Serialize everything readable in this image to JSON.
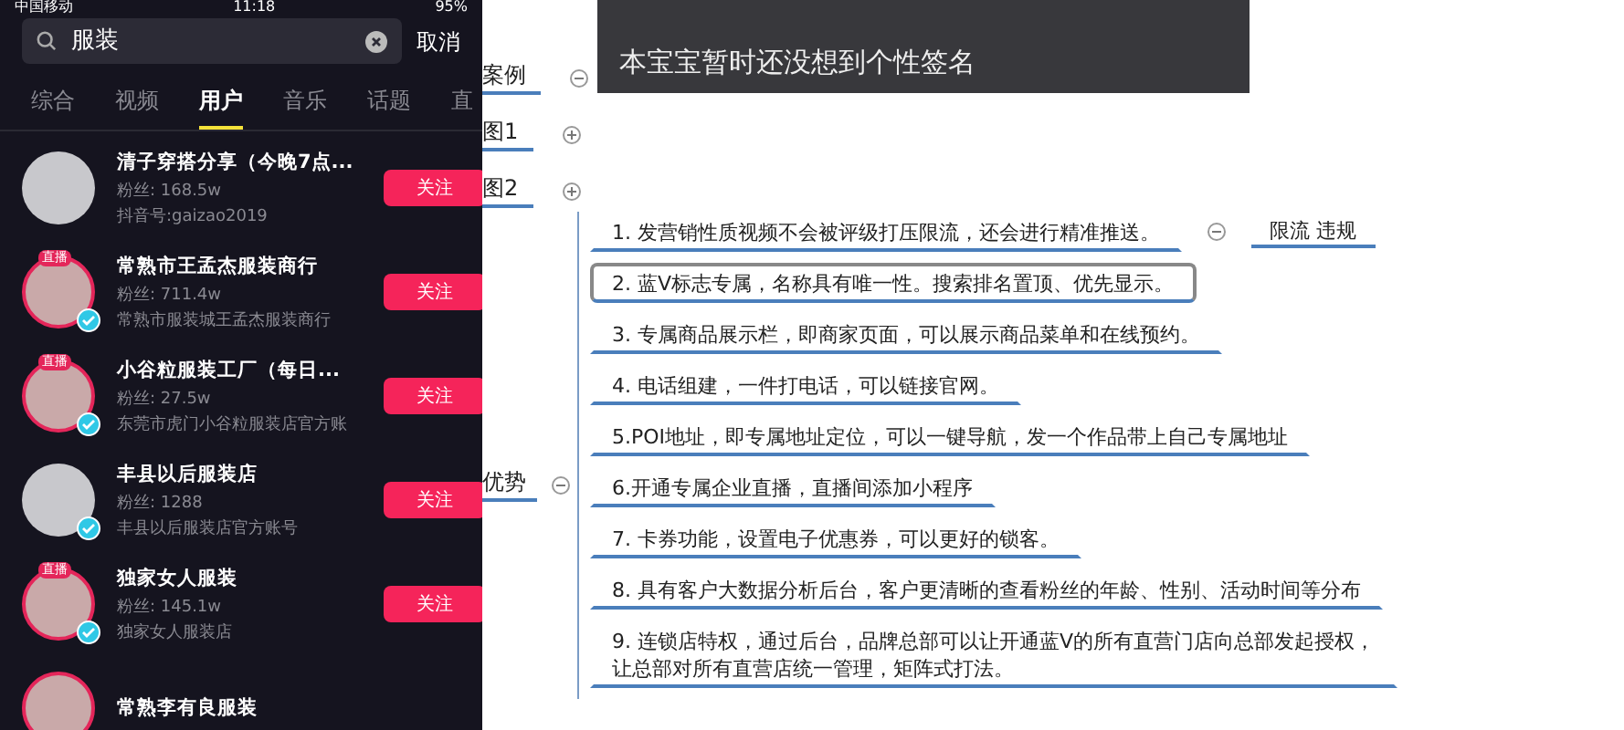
{
  "phone": {
    "status_bar": {
      "carrier": "中国移动",
      "time": "11:18",
      "battery": "95%"
    },
    "search": {
      "value": "服装",
      "cancel": "取消"
    },
    "tabs": [
      {
        "label": "综合",
        "selected": false
      },
      {
        "label": "视频",
        "selected": false
      },
      {
        "label": "用户",
        "selected": true
      },
      {
        "label": "音乐",
        "selected": false
      },
      {
        "label": "话题",
        "selected": false
      },
      {
        "label": "直",
        "selected": false
      }
    ],
    "users": [
      {
        "name": "清子穿搭分享（今晚7点...",
        "fans": "粉丝: 168.5w",
        "sub": "抖音号:gaizao2019",
        "live": false,
        "verified": false,
        "button": "关注"
      },
      {
        "name": "常熟市王孟杰服装商行",
        "fans": "粉丝: 711.4w",
        "sub": "常熟市服装城王孟杰服装商行",
        "live": true,
        "live_badge": "直播",
        "verified": true,
        "button": "关注"
      },
      {
        "name": "小谷粒服装工厂（每日...",
        "fans": "粉丝: 27.5w",
        "sub": "东莞市虎门小谷粒服装店官方账",
        "live": true,
        "live_badge": "直播",
        "verified": true,
        "button": "关注"
      },
      {
        "name": "丰县以后服装店",
        "fans": "粉丝: 1288",
        "sub": "丰县以后服装店官方账号",
        "live": false,
        "verified": true,
        "button": "关注"
      },
      {
        "name": "独家女人服装",
        "fans": "粉丝: 145.1w",
        "sub": "独家女人服装店",
        "live": true,
        "live_badge": "直播",
        "verified": true,
        "button": "关注"
      },
      {
        "name": "常熟李有良服装",
        "live": true,
        "verified": false
      }
    ]
  },
  "mindmap": {
    "popup": {
      "text": "本宝宝暂时还没想到个性签名"
    },
    "side_nodes": [
      {
        "label": "案例",
        "expanded": true
      },
      {
        "label": "图1",
        "expanded": false
      },
      {
        "label": "图2",
        "expanded": false
      }
    ],
    "branch": {
      "label": "优势",
      "expanded": true,
      "children": [
        {
          "text": "1. 发营销性质视频不会被评级打压限流，还会进行精准推送。",
          "selected": false,
          "expanded": true,
          "children": [
            {
              "text": "限流 违规"
            }
          ]
        },
        {
          "text": "2. 蓝V标志专属，名称具有唯一性。搜索排名置顶、优先显示。",
          "selected": true
        },
        {
          "text": "3. 专属商品展示栏，即商家页面，可以展示商品菜单和在线预约。",
          "selected": false
        },
        {
          "text": "4. 电话组建，一件打电话，可以链接官网。",
          "selected": false
        },
        {
          "text": "5.POI地址，即专属地址定位，可以一键导航，发一个作品带上自己专属地址",
          "selected": false
        },
        {
          "text": "6.开通专属企业直播，直播间添加小程序",
          "selected": false
        },
        {
          "text": "7. 卡券功能，设置电子优惠券，可以更好的锁客。",
          "selected": false
        },
        {
          "text": "8. 具有客户大数据分析后台，客户更清晰的查看粉丝的年龄、性别、活动时间等分布",
          "selected": false
        },
        {
          "lines": [
            "9. 连锁店特权，通过后台，品牌总部可以让开通蓝V的所有直营门店向总部发起授权，",
            "让总部对所有直营店统一管理，矩阵式打法。"
          ],
          "selected": false
        }
      ]
    }
  }
}
